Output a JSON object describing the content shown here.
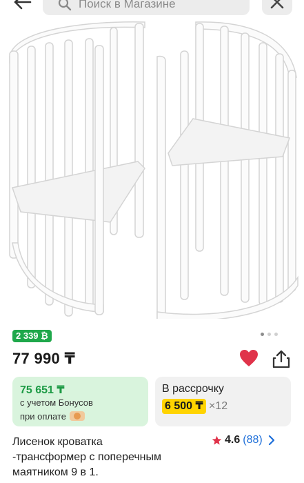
{
  "header": {
    "search_placeholder": "Поиск в Магазине"
  },
  "product": {
    "bonus_badge": "2 339 ₿",
    "price": "77 990 ₸",
    "title_lines": [
      "Лисенок кроватка",
      "-трансформер с поперечным",
      "маятником 9 в 1."
    ],
    "rating": "4.6",
    "reviews_count": "(88)"
  },
  "gallery": {
    "dot_count": 3,
    "active_index": 0
  },
  "bonus_card": {
    "amount": "75 651 ₸",
    "line1": "с учетом Бонусов",
    "line2": "при оплате"
  },
  "installment_card": {
    "title": "В рассрочку",
    "monthly": "6 500 ₸",
    "multiplier": "×12"
  },
  "colors": {
    "accent_green": "#1fa84b",
    "heart_red": "#e0334a",
    "installment_yellow": "#ffd400",
    "link_blue": "#1e6fd9"
  }
}
